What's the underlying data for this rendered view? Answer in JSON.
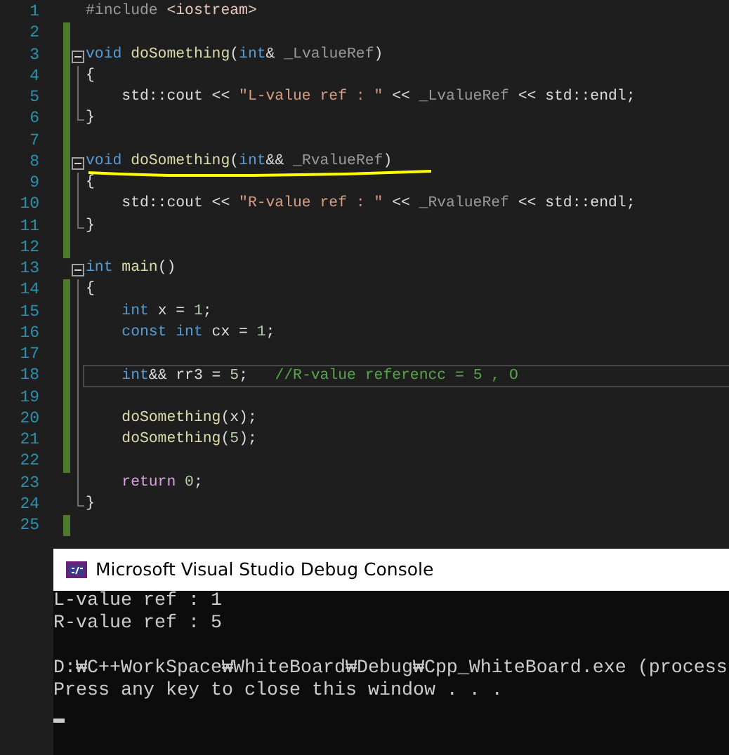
{
  "editor": {
    "lines": [
      {
        "number": "1",
        "kind": "plain",
        "changed": false,
        "current": false,
        "tokens": [
          {
            "kind": "preprocessor",
            "text": "#include "
          },
          {
            "kind": "include",
            "text": "<iostream>"
          }
        ]
      },
      {
        "number": "2",
        "kind": "plain",
        "changed": true,
        "current": false
      },
      {
        "number": "3",
        "kind": "header",
        "changed": true,
        "current": false,
        "tokens": [
          {
            "kind": "keyword",
            "text": "void"
          },
          {
            "kind": "function",
            "text": " doSomething"
          },
          {
            "kind": "plain",
            "text": "("
          },
          {
            "kind": "keyword",
            "text": "int"
          },
          {
            "kind": "plain",
            "text": "& "
          },
          {
            "kind": "param",
            "text": "_LvalueRef"
          },
          {
            "kind": "plain",
            "text": ")"
          }
        ]
      },
      {
        "number": "4",
        "kind": "body",
        "changed": true,
        "current": false,
        "tokens": [
          {
            "kind": "plain",
            "text": "{"
          }
        ]
      },
      {
        "number": "5",
        "kind": "body",
        "changed": true,
        "current": false,
        "tokens": [
          {
            "kind": "plain",
            "text": "    std::cout << "
          },
          {
            "kind": "string",
            "text": "\"L-value ref : \""
          },
          {
            "kind": "plain",
            "text": " << "
          },
          {
            "kind": "param",
            "text": "_LvalueRef"
          },
          {
            "kind": "plain",
            "text": " << std::endl;"
          }
        ]
      },
      {
        "number": "6",
        "kind": "closing",
        "changed": true,
        "current": false,
        "tokens": [
          {
            "kind": "plain",
            "text": "}"
          }
        ]
      },
      {
        "number": "7",
        "kind": "plain",
        "changed": true,
        "current": false
      },
      {
        "number": "8",
        "kind": "header",
        "changed": true,
        "current": false,
        "tokens": [
          {
            "kind": "keyword",
            "text": "void"
          },
          {
            "kind": "function",
            "text": " doSomething"
          },
          {
            "kind": "plain",
            "text": "("
          },
          {
            "kind": "keyword",
            "text": "int"
          },
          {
            "kind": "plain",
            "text": "&& "
          },
          {
            "kind": "param",
            "text": "_RvalueRef"
          },
          {
            "kind": "plain",
            "text": ")"
          }
        ]
      },
      {
        "number": "9",
        "kind": "body",
        "changed": true,
        "current": false,
        "tokens": [
          {
            "kind": "plain",
            "text": "{"
          }
        ]
      },
      {
        "number": "10",
        "kind": "body",
        "changed": true,
        "current": false,
        "tokens": [
          {
            "kind": "plain",
            "text": "    std::cout << "
          },
          {
            "kind": "string",
            "text": "\"R-value ref : \""
          },
          {
            "kind": "plain",
            "text": " << "
          },
          {
            "kind": "param",
            "text": "_RvalueRef"
          },
          {
            "kind": "plain",
            "text": " << std::endl;"
          }
        ]
      },
      {
        "number": "11",
        "kind": "closing",
        "changed": true,
        "current": false,
        "tokens": [
          {
            "kind": "plain",
            "text": "}"
          }
        ]
      },
      {
        "number": "12",
        "kind": "plain",
        "changed": true,
        "current": false
      },
      {
        "number": "13",
        "kind": "header",
        "changed": false,
        "current": false,
        "tokens": [
          {
            "kind": "keyword",
            "text": "int"
          },
          {
            "kind": "function",
            "text": " main"
          },
          {
            "kind": "plain",
            "text": "()"
          }
        ]
      },
      {
        "number": "14",
        "kind": "body",
        "changed": true,
        "current": false,
        "tokens": [
          {
            "kind": "plain",
            "text": "{"
          }
        ]
      },
      {
        "number": "15",
        "kind": "body",
        "changed": true,
        "current": false,
        "tokens": [
          {
            "kind": "keyword",
            "text": "    int"
          },
          {
            "kind": "plain",
            "text": " x = "
          },
          {
            "kind": "number",
            "text": "1"
          },
          {
            "kind": "plain",
            "text": ";"
          }
        ]
      },
      {
        "number": "16",
        "kind": "body",
        "changed": true,
        "current": false,
        "tokens": [
          {
            "kind": "keyword",
            "text": "    const int"
          },
          {
            "kind": "plain",
            "text": " cx = "
          },
          {
            "kind": "number",
            "text": "1"
          },
          {
            "kind": "plain",
            "text": ";"
          }
        ]
      },
      {
        "number": "17",
        "kind": "body",
        "changed": true,
        "current": false
      },
      {
        "number": "18",
        "kind": "body",
        "changed": true,
        "current": true,
        "tokens": [
          {
            "kind": "keyword",
            "text": "    int"
          },
          {
            "kind": "plain",
            "text": "&& rr3 = "
          },
          {
            "kind": "number",
            "text": "5"
          },
          {
            "kind": "plain",
            "text": ";"
          },
          {
            "kind": "comment",
            "text": "   //R-value referencc = 5 , O"
          }
        ]
      },
      {
        "number": "19",
        "kind": "body",
        "changed": true,
        "current": false
      },
      {
        "number": "20",
        "kind": "body",
        "changed": true,
        "current": false,
        "tokens": [
          {
            "kind": "function",
            "text": "    doSomething"
          },
          {
            "kind": "plain",
            "text": "(x);"
          }
        ]
      },
      {
        "number": "21",
        "kind": "body",
        "changed": true,
        "current": false,
        "tokens": [
          {
            "kind": "function",
            "text": "    doSomething"
          },
          {
            "kind": "plain",
            "text": "("
          },
          {
            "kind": "number",
            "text": "5"
          },
          {
            "kind": "plain",
            "text": ");"
          }
        ]
      },
      {
        "number": "22",
        "kind": "body",
        "changed": true,
        "current": false
      },
      {
        "number": "23",
        "kind": "body",
        "changed": false,
        "current": false,
        "tokens": [
          {
            "kind": "control",
            "text": "    return"
          },
          {
            "kind": "number",
            "text": " 0"
          },
          {
            "kind": "plain",
            "text": ";"
          }
        ]
      },
      {
        "number": "24",
        "kind": "closing",
        "changed": false,
        "current": false,
        "tokens": [
          {
            "kind": "plain",
            "text": "}"
          }
        ]
      },
      {
        "number": "25",
        "kind": "plain",
        "changed": true,
        "current": false
      }
    ]
  },
  "console": {
    "title": "Microsoft Visual Studio Debug Console",
    "blocks": [
      {
        "lines": [
          "L-value ref : 1",
          "R-value ref : 5"
        ]
      },
      {
        "lines": [
          "D:₩C++WorkSpace₩WhiteBoard₩Debug₩Cpp_WhiteBoard.exe (process",
          "Press any key to close this window . . ."
        ]
      }
    ]
  }
}
